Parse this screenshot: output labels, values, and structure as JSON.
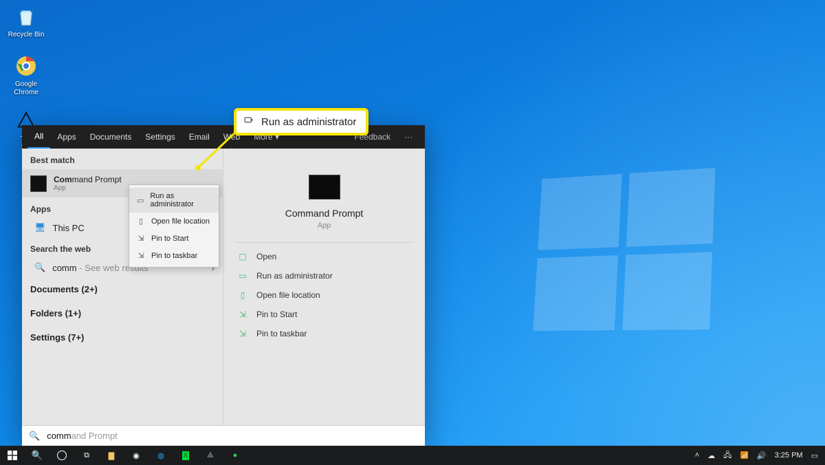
{
  "desktop_icons": {
    "recycle": "Recycle Bin",
    "chrome": "Google Chrome",
    "thescr": "The\nScr"
  },
  "callout": {
    "label": "Run as administrator"
  },
  "search": {
    "tabs": [
      "All",
      "Apps",
      "Documents",
      "Settings",
      "Email",
      "Web",
      "More"
    ],
    "tabs_right": "Feedback",
    "best_match_label": "Best match",
    "best_match": {
      "title": "Command Prompt",
      "subtitle": "App"
    },
    "context_items": [
      "Run as administrator",
      "Open file location",
      "Pin to Start",
      "Pin to taskbar"
    ],
    "apps_label": "Apps",
    "apps_items": [
      "This PC"
    ],
    "web_label": "Search the web",
    "web_query": "comm",
    "web_hint": "See web results",
    "docs_label": "Documents (2+)",
    "folders_label": "Folders (1+)",
    "settings_label": "Settings (7+)",
    "preview": {
      "title": "Command Prompt",
      "type": "App",
      "actions": [
        "Open",
        "Run as administrator",
        "Open file location",
        "Pin to Start",
        "Pin to taskbar"
      ]
    },
    "input_typed": "comm",
    "input_suggest": "and Prompt"
  },
  "taskbar": {
    "time": "3:25 PM"
  }
}
